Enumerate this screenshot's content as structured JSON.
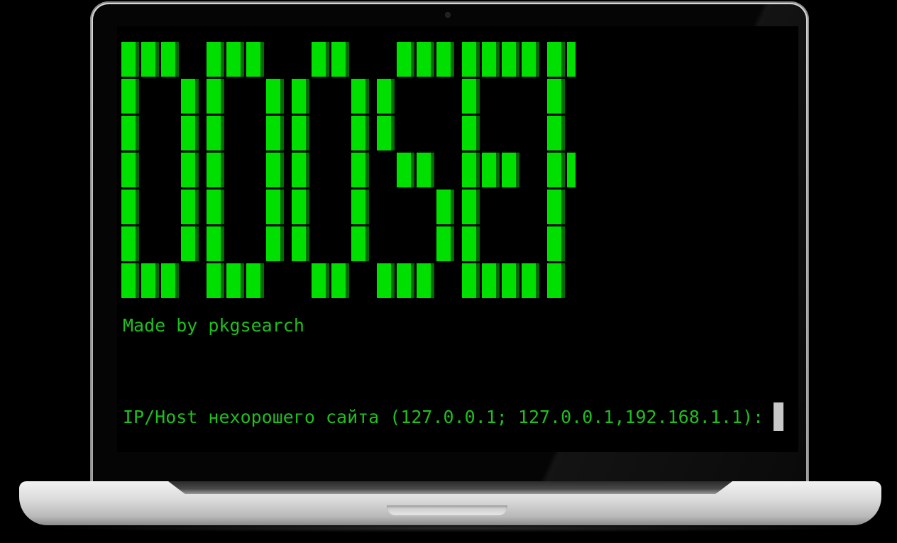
{
  "terminal": {
    "banner_text": "DDOSER",
    "credit_text": "Made by pkgsearch",
    "prompt_text": "IP/Host нехорошего сайта (127.0.0.1; 127.0.0.1,192.168.1.1):",
    "text_color": "#1fbf1f",
    "banner_color": "#00e000",
    "background_color": "#000000"
  }
}
